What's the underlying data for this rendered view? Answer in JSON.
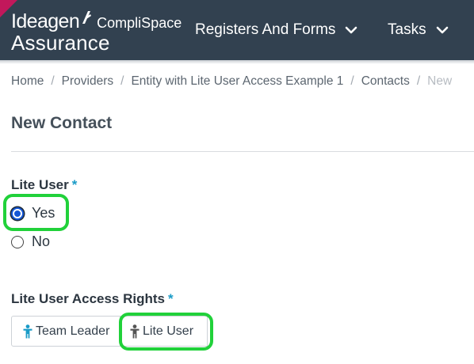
{
  "header": {
    "brand": {
      "wordmark": "Ideagen",
      "product": "CompliSpace",
      "subtitle": "Assurance"
    },
    "nav": [
      {
        "label": "Registers And Forms",
        "icon": "chevron-down-icon"
      },
      {
        "label": "Tasks",
        "icon": "chevron-down-icon"
      }
    ],
    "colors": {
      "background": "#324150",
      "accent": "#c2185b"
    }
  },
  "breadcrumb": {
    "items": [
      "Home",
      "Providers",
      "Entity with Lite User Access Example 1",
      "Contacts"
    ],
    "current": "New",
    "separator": "/"
  },
  "page": {
    "title": "New Contact"
  },
  "form": {
    "lite_user": {
      "label": "Lite User",
      "required_marker": "*",
      "options": [
        "Yes",
        "No"
      ],
      "selected": "Yes"
    },
    "access_rights": {
      "label": "Lite User Access Rights",
      "required_marker": "*",
      "buttons": [
        {
          "label": "Team Leader",
          "icon": "person-icon",
          "icon_color": "#1a9bc7"
        },
        {
          "label": "Lite User",
          "icon": "person-icon",
          "icon_color": "#555555"
        }
      ]
    }
  },
  "highlight_color": "#21d13a"
}
